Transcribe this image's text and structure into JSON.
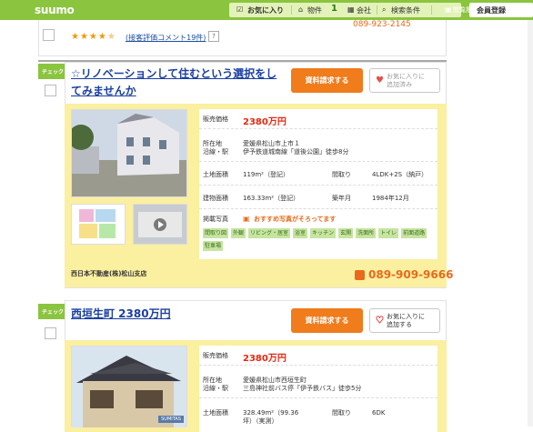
{
  "header": {
    "logo": "suumo",
    "nav": {
      "fav": "お気に入り",
      "fav_count_label": "物件",
      "fav_count": "1",
      "company": "会社",
      "search_cond": "検索条件",
      "history": "閲覧履歴"
    },
    "member": "会員登録"
  },
  "prev_listing": {
    "phone": "089-923-2145",
    "review_link": "(接客評価コメント19件)",
    "help": "?"
  },
  "listings": [
    {
      "check_tag": "チェック",
      "title_line1": "☆リノベーションして住むという選択をし",
      "title_line2": "てみませんか",
      "request_btn": "資料請求する",
      "fav_btn_l1": "お気に入りに",
      "fav_btn_l2": "追加済み",
      "price_label": "販売価格",
      "price": "2380万円",
      "loc_label1": "所在地",
      "loc_label2": "沿線・駅",
      "address": "愛媛県松山市上市１",
      "station": "伊予鉄道城南線「道後公園」徒歩8分",
      "land_label": "土地面積",
      "land": "119m²（登記）",
      "layout_label": "間取り",
      "layout": "4LDK+2S（納戸）",
      "bldg_label": "建物面積",
      "bldg": "163.33m²（登記）",
      "built_label": "築年月",
      "built": "1984年12月",
      "photo_label": "掲載写真",
      "photo_note": "おすすめ写真がそろってます",
      "chips": [
        "間取り図",
        "外観",
        "リビング・居室",
        "浴室",
        "キッチン",
        "玄関",
        "洗面所",
        "トイレ",
        "前面道路",
        "駐車場"
      ],
      "agent": "西日本不動産(株)松山支店",
      "phone": "089-909-9666"
    },
    {
      "check_tag": "チェック",
      "title": "西垣生町 2380万円",
      "request_btn": "資料請求する",
      "fav_btn_l1": "お気に入りに",
      "fav_btn_l2": "追加する",
      "price_label": "販売価格",
      "price": "2380万円",
      "loc_label1": "所在地",
      "loc_label2": "沿線・駅",
      "address": "愛媛県松山市西垣生町",
      "station": "三島神社前バス停「伊予鉄バス」徒歩5分",
      "land_label": "土地面積",
      "land": "328.49m²（99.36",
      "land2": "坪）（実測）",
      "layout_label": "間取り",
      "layout": "6DK",
      "photo_badge": "SUMITAS"
    }
  ]
}
